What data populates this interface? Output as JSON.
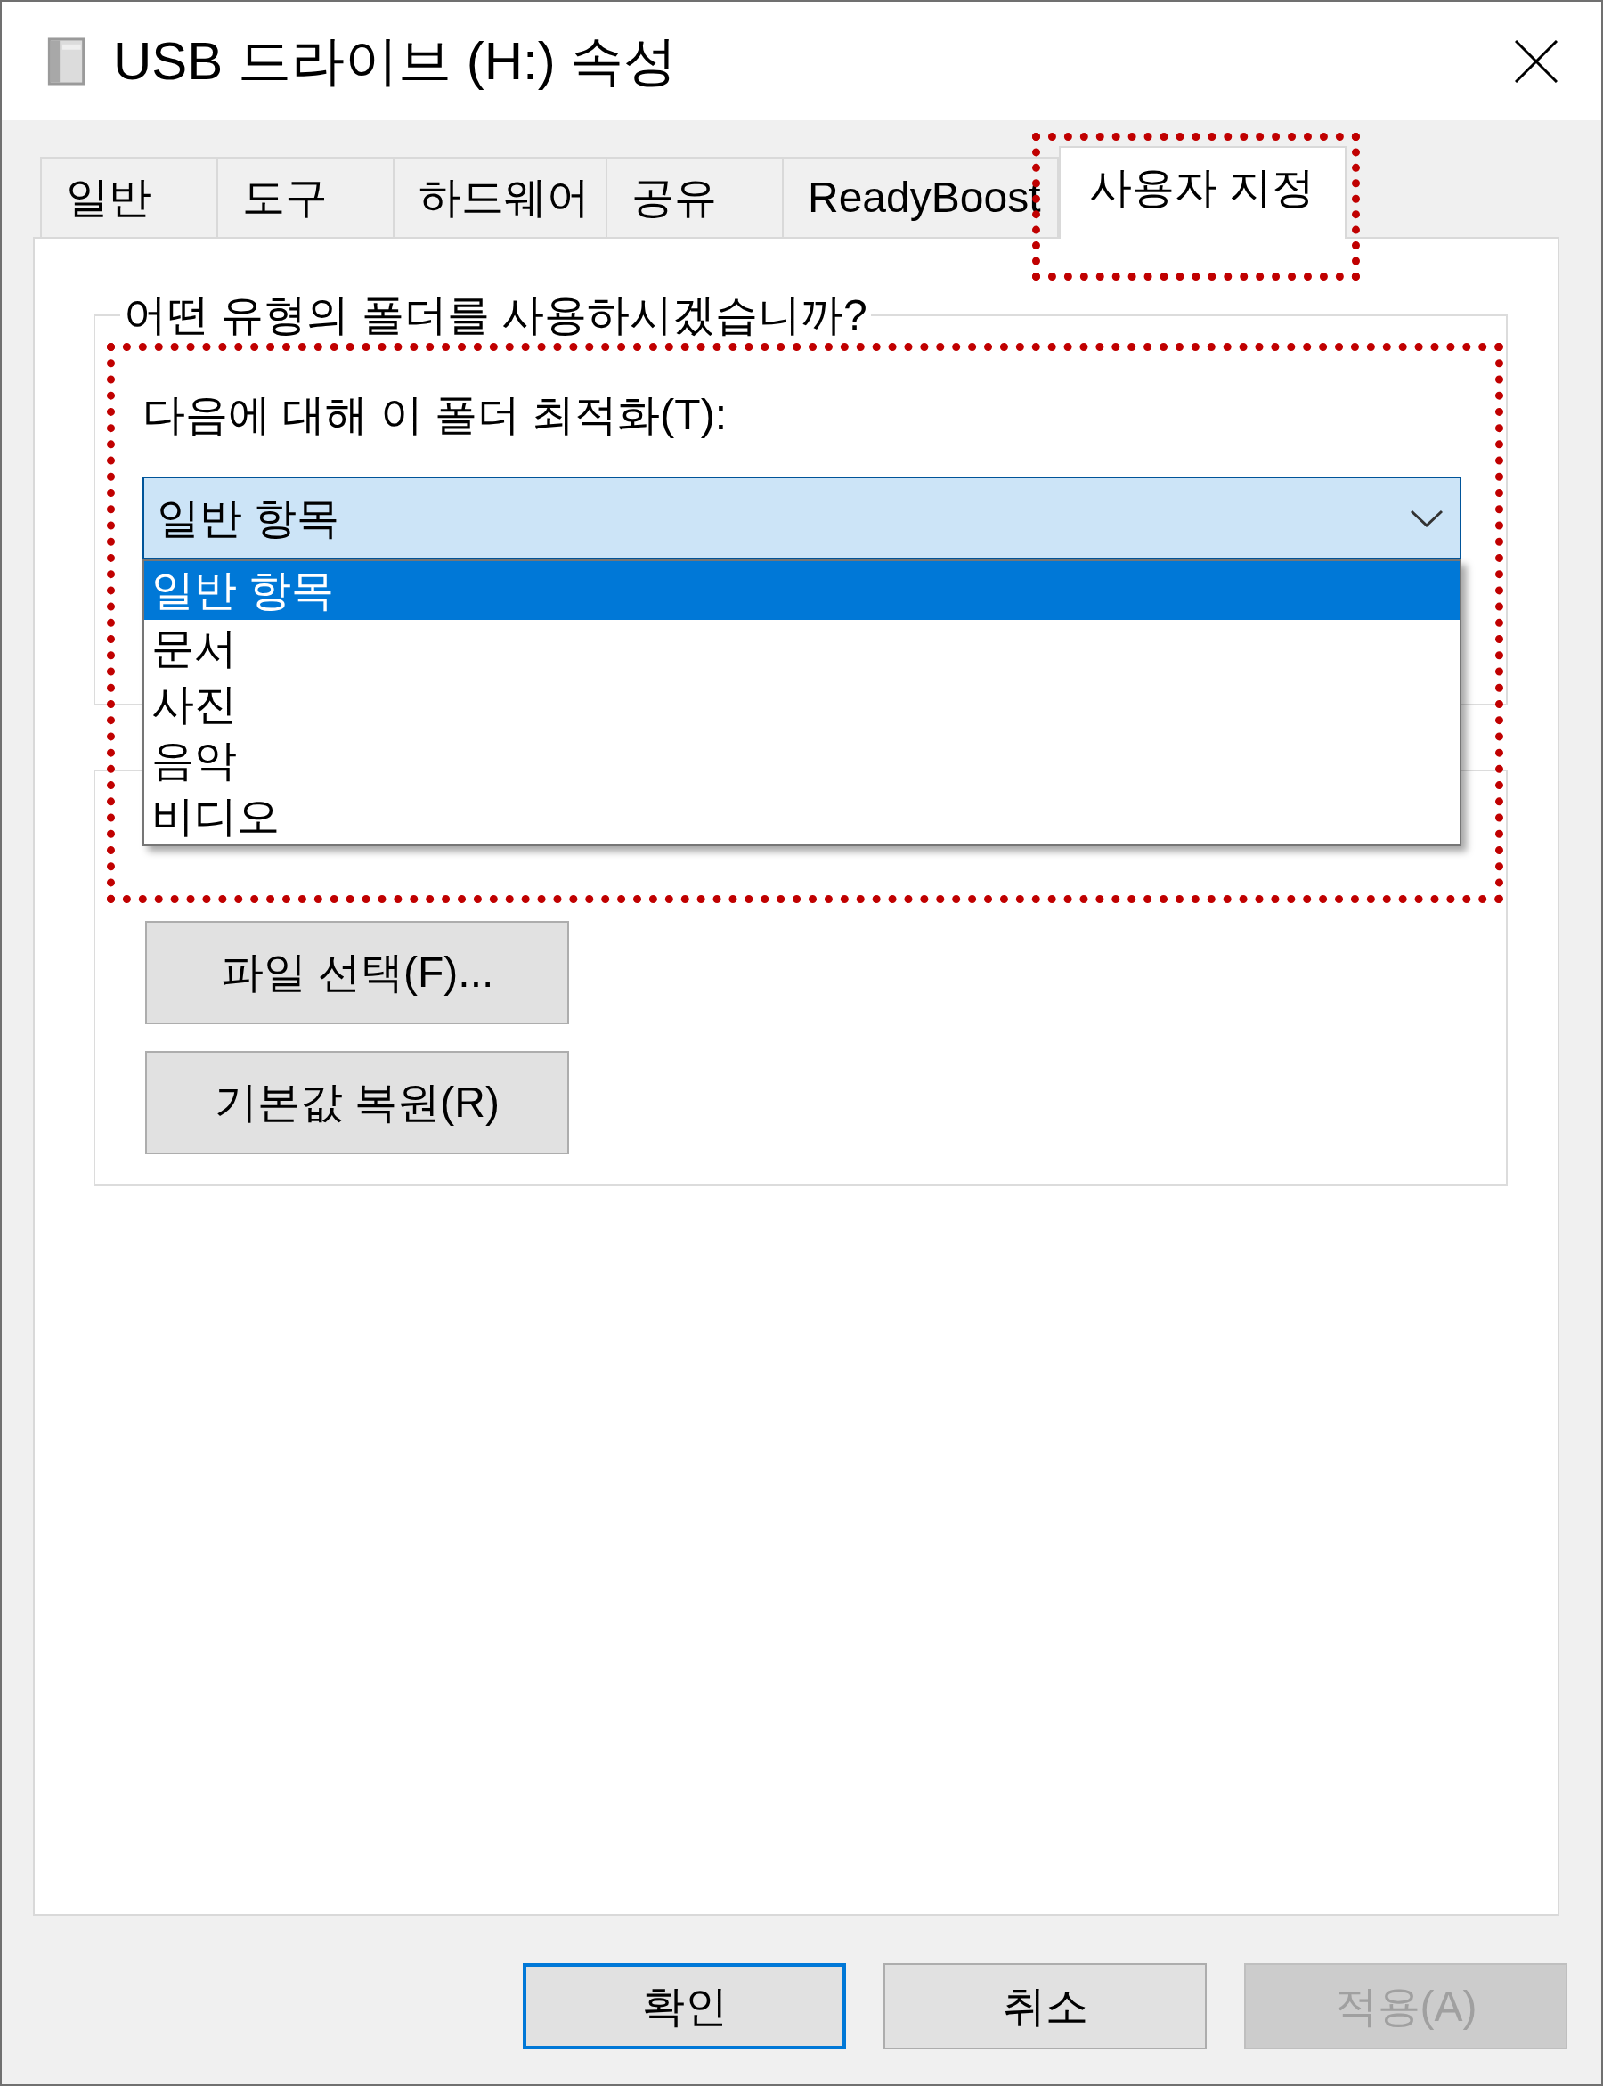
{
  "window": {
    "title": "USB 드라이브 (H:) 속성"
  },
  "tabs": [
    {
      "label": "일반",
      "selected": false,
      "highlighted": false
    },
    {
      "label": "도구",
      "selected": false,
      "highlighted": false
    },
    {
      "label": "하드웨어",
      "selected": false,
      "highlighted": false
    },
    {
      "label": "공유",
      "selected": false,
      "highlighted": false
    },
    {
      "label": "ReadyBoost",
      "selected": false,
      "highlighted": false
    },
    {
      "label": "사용자 지정",
      "selected": true,
      "highlighted": true
    }
  ],
  "folder_type_group": {
    "legend": "어떤 유형의 폴더를 사용하시겠습니까?",
    "highlighted": true,
    "optimize_label": "다음에 대해 이 폴더 최적화(T):",
    "dropdown": {
      "value": "일반 항목",
      "expanded": true,
      "options": [
        {
          "label": "일반 항목",
          "selected": true
        },
        {
          "label": "문서",
          "selected": false
        },
        {
          "label": "사진",
          "selected": false
        },
        {
          "label": "음악",
          "selected": false
        },
        {
          "label": "비디오",
          "selected": false
        }
      ]
    }
  },
  "folder_pictures_group": {
    "buttons": [
      {
        "label": "파일 선택(F)..."
      },
      {
        "label": "기본값 복원(R)"
      }
    ]
  },
  "buttons": [
    {
      "label": "확인",
      "default": true,
      "disabled": false
    },
    {
      "label": "취소",
      "default": false,
      "disabled": false
    },
    {
      "label": "적용(A)",
      "default": false,
      "disabled": true
    }
  ]
}
